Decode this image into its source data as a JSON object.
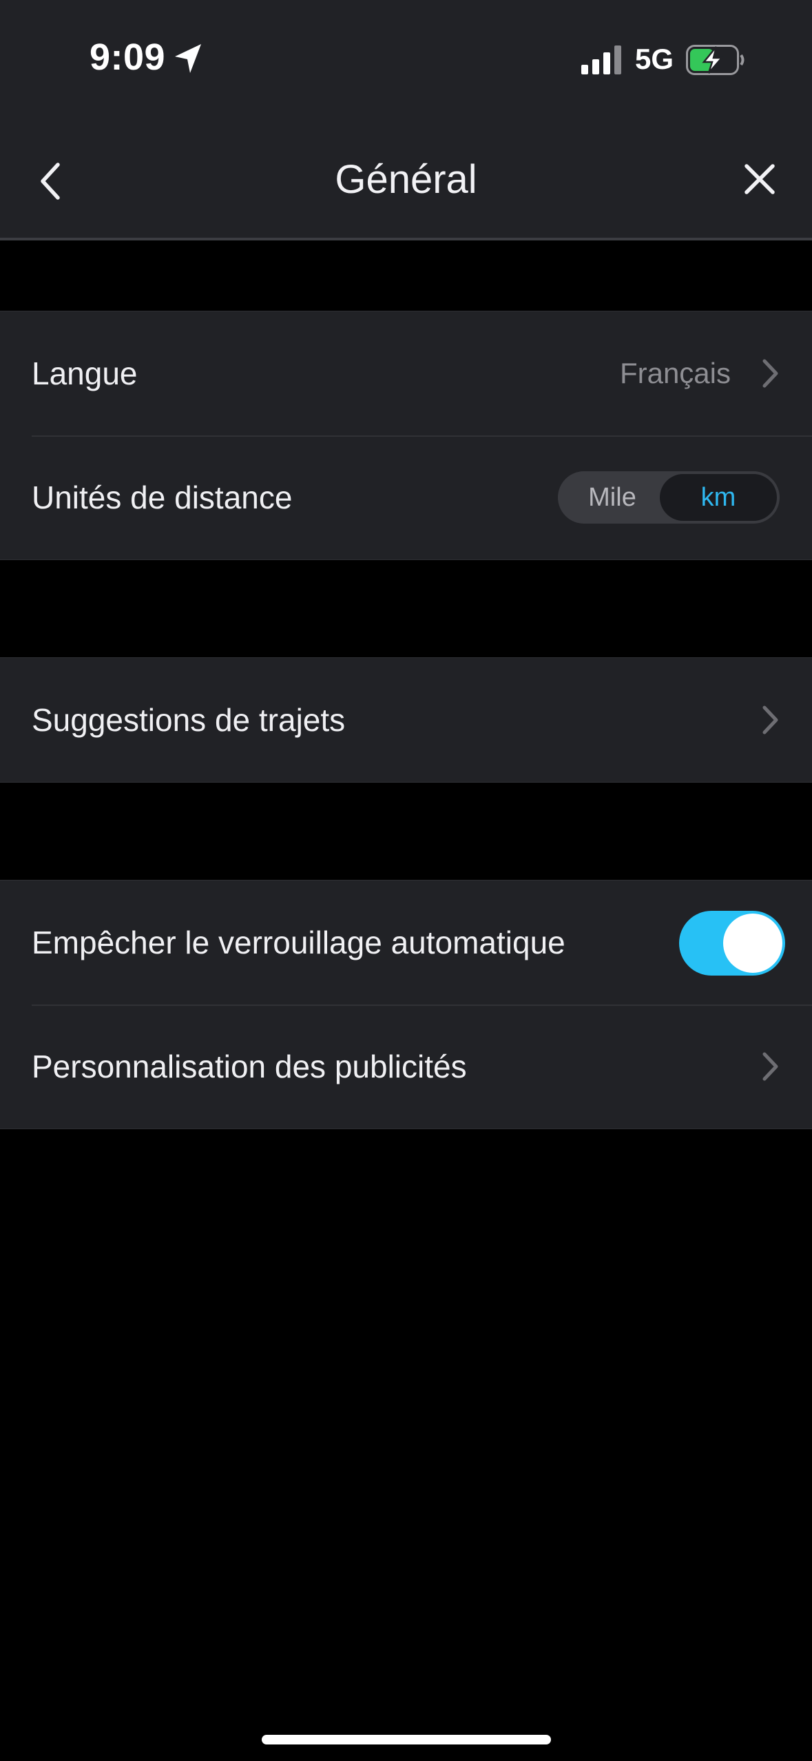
{
  "status_bar": {
    "time": "9:09",
    "network": "5G",
    "location_icon": "location-arrow-icon",
    "signal_icon": "cellular-signal-icon",
    "battery_icon": "battery-charging-icon"
  },
  "header": {
    "title": "Général",
    "back_icon": "chevron-left-icon",
    "close_icon": "close-icon"
  },
  "groups": [
    {
      "rows": [
        {
          "label": "Langue",
          "value": "Français",
          "control": "chevron"
        },
        {
          "label": "Unités de distance",
          "control": "segmented",
          "options": [
            "Mile",
            "km"
          ],
          "selected": "km"
        }
      ]
    },
    {
      "rows": [
        {
          "label": "Suggestions de trajets",
          "control": "chevron"
        }
      ]
    },
    {
      "rows": [
        {
          "label": "Empêcher le verrouillage automatique",
          "control": "toggle",
          "on": true
        },
        {
          "label": "Personnalisation des publicités",
          "control": "chevron"
        }
      ]
    }
  ],
  "colors": {
    "accent": "#27c1f5",
    "selected_text": "#2fb8f0",
    "surface": "#212226",
    "background": "#000000",
    "battery_fill": "#34c759"
  }
}
